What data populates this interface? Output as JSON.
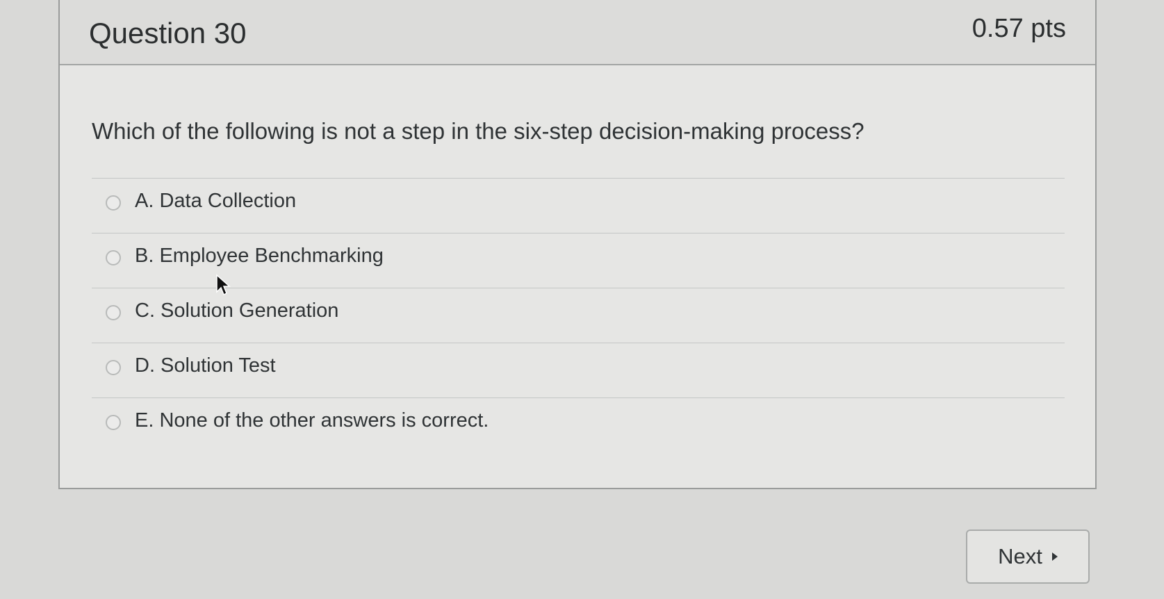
{
  "question": {
    "title": "Question 30",
    "points": "0.57 pts",
    "text": "Which of the following is not a step in the six-step decision-making process?",
    "answers": [
      {
        "label": "A. Data Collection",
        "selected": false
      },
      {
        "label": "B. Employee Benchmarking",
        "selected": false
      },
      {
        "label": "C. Solution Generation",
        "selected": false
      },
      {
        "label": "D. Solution Test",
        "selected": false
      },
      {
        "label": "E. None of the other answers is correct.",
        "selected": false
      }
    ]
  },
  "navigation": {
    "next_label": "Next",
    "next_icon": "caret-right-icon"
  },
  "colors": {
    "background": "#d9d9d7",
    "card": "#e6e6e4",
    "text": "#2f3335"
  }
}
